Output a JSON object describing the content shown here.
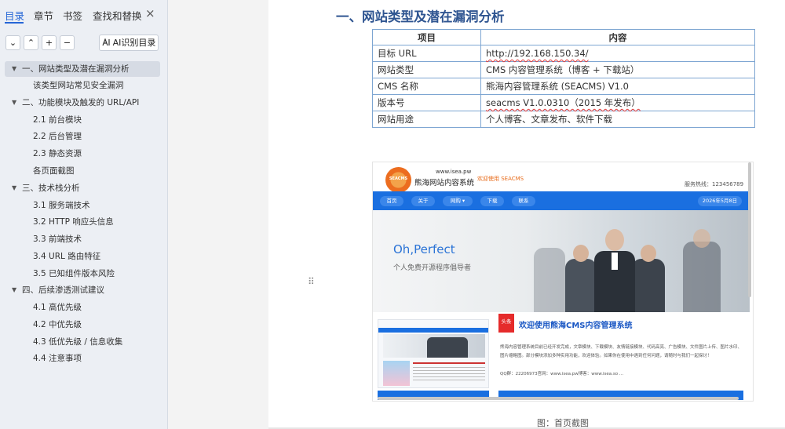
{
  "sidebar": {
    "tabs": [
      {
        "label": "目录"
      },
      {
        "label": "章节"
      },
      {
        "label": "书签"
      },
      {
        "label": "查找和替换"
      }
    ],
    "close_glyph": "×",
    "toolbar": {
      "expand_glyph": "⌄",
      "collapse_glyph": "⌃",
      "add_glyph": "+",
      "remove_glyph": "−",
      "ai_label": "AI识别目录"
    },
    "toc": [
      {
        "label": "一、网站类型及潜在漏洞分析",
        "level": 1
      },
      {
        "label": "该类型网站常见安全漏洞",
        "level": 2
      },
      {
        "label": "二、功能模块及触发的 URL/API",
        "level": 1
      },
      {
        "label": "2.1 前台模块",
        "level": 2
      },
      {
        "label": "2.2 后台管理",
        "level": 2
      },
      {
        "label": "2.3 静态资源",
        "level": 2
      },
      {
        "label": "各页面截图",
        "level": 2
      },
      {
        "label": "三、技术栈分析",
        "level": 1
      },
      {
        "label": "3.1 服务端技术",
        "level": 2
      },
      {
        "label": "3.2 HTTP 响应头信息",
        "level": 2
      },
      {
        "label": "3.3 前端技术",
        "level": 2
      },
      {
        "label": "3.4 URL 路由特征",
        "level": 2
      },
      {
        "label": "3.5 已知组件版本风险",
        "level": 2
      },
      {
        "label": "四、后续渗透测试建议",
        "level": 1
      },
      {
        "label": "4.1 高优先级",
        "level": 2
      },
      {
        "label": "4.2 中优先级",
        "level": 2
      },
      {
        "label": "4.3 低优先级 / 信息收集",
        "level": 2
      },
      {
        "label": "4.4 注意事项",
        "level": 2
      }
    ]
  },
  "document": {
    "heading": "一、网站类型及潜在漏洞分析",
    "table": {
      "headers": [
        "项目",
        "内容"
      ],
      "rows": [
        [
          "目标 URL",
          "http://192.168.150.34/"
        ],
        [
          "网站类型",
          "CMS 内容管理系统（博客 + 下载站）"
        ],
        [
          "CMS 名称",
          "熊海内容管理系统 (SEACMS) V1.0"
        ],
        [
          "版本号",
          "seacms V1.0.0310（2015 年发布）"
        ],
        [
          "网站用途",
          "个人博客、文章发布、软件下载"
        ]
      ]
    },
    "screenshot": {
      "logo_text": "SEACMS",
      "site_url": "www.isea.pw",
      "site_name": "熊海网站内容系统",
      "welcome": "欢迎使用 SEACMS",
      "hotline": "服务热线：123456789",
      "nav": [
        "首页",
        "关于",
        "网购 ▾",
        "下载",
        "联系"
      ],
      "date": "2026年5月8日",
      "hero_title": "Oh,Perfect",
      "hero_sub": "个人免费开源程序倡导者",
      "badge": "头条",
      "news_title": "欢迎使用熊海CMS内容管理系统",
      "news_body": "熊海内容管理系统目前已经开发完成，文章模块、下载模块、友情链接模块、代码高亮、广告模块、文件图片上传、图片水印、图片缩略图。部分模块添加多种实用功能，欢迎体验。如果你在使用中遇到任何问题，请随时与我们一起探讨！",
      "news_meta": "QQ群：22206973官网：www.isea.pw博客：www.isea.so ..."
    },
    "caption": "图：首页截图"
  },
  "colors": {
    "accent": "#2566d6",
    "heading": "#2f5591",
    "table_border": "#7ea6d2",
    "site_nav": "#1a6fe0",
    "site_orange": "#ec6d1f"
  }
}
